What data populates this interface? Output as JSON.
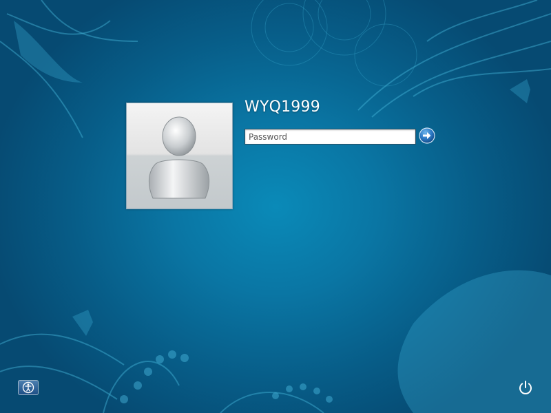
{
  "user": {
    "name": "WYQ1999"
  },
  "password": {
    "placeholder": "Password",
    "value": ""
  },
  "icons": {
    "avatar": "user-silhouette-icon",
    "go": "arrow-right-icon",
    "ease_of_access": "ease-of-access-icon",
    "power": "power-icon"
  },
  "colors": {
    "background_center": "#0a8ab8",
    "background_edge": "#064a72",
    "text": "#ffffff"
  }
}
